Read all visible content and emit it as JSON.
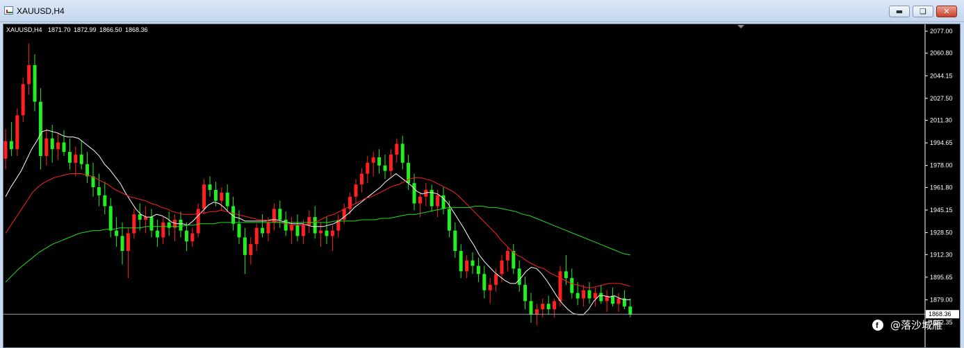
{
  "window": {
    "title": "XAUUSD,H4",
    "minimize_icon": "minimize-icon",
    "restore_icon": "restore-icon",
    "close_icon": "close-icon"
  },
  "chart_header": {
    "symbol": "XAUUSD,H4",
    "open": "1871.70",
    "high": "1872.99",
    "low": "1866.50",
    "close": "1868.36"
  },
  "watermark": {
    "icon": "facebook-icon",
    "text": "@落沙城雁"
  },
  "chart_data": {
    "type": "candlestick",
    "title": "",
    "ylim": [
      1862.35,
      2077.0
    ],
    "y_ticks": [
      "2077.00",
      "2060.80",
      "2044.15",
      "2027.50",
      "2011.30",
      "1994.65",
      "1978.00",
      "1961.80",
      "1945.15",
      "1928.50",
      "1912.30",
      "1895.65",
      "1879.00",
      "1862.35"
    ],
    "current_price": 1868.36,
    "colors": {
      "bull": "#ff2020",
      "bear": "#22ee22",
      "background": "#000000",
      "price_line": "#9aa4b0"
    },
    "moving_averages": [
      {
        "color": "#ffffff",
        "values": [
          1955,
          1962,
          1968,
          1974,
          1982,
          1990,
          1996,
          2003,
          2004,
          2003,
          2002,
          2000,
          1999,
          1999,
          1998,
          1995,
          1992,
          1989,
          1985,
          1979,
          1975,
          1970,
          1965,
          1958,
          1952,
          1946,
          1942,
          1940,
          1940,
          1942,
          1941,
          1939,
          1936,
          1935,
          1935,
          1934,
          1937,
          1941,
          1945,
          1949,
          1951,
          1950,
          1947,
          1943,
          1940,
          1939,
          1937,
          1937,
          1937,
          1937,
          1937,
          1938,
          1938,
          1937,
          1936,
          1935,
          1935,
          1935,
          1934,
          1933,
          1933,
          1933,
          1934,
          1935,
          1937,
          1940,
          1943,
          1947,
          1950,
          1953,
          1956,
          1959,
          1962,
          1966,
          1969,
          1972,
          1969,
          1966,
          1963,
          1959,
          1957,
          1958,
          1958,
          1957,
          1954,
          1950,
          1944,
          1938,
          1932,
          1925,
          1919,
          1912,
          1907,
          1903,
          1899,
          1896,
          1893,
          1891,
          1891,
          1895,
          1900,
          1903,
          1902,
          1898,
          1893,
          1887,
          1881,
          1876,
          1872,
          1869,
          1868,
          1868,
          1872,
          1878,
          1882,
          1882,
          1881,
          1882,
          1880,
          1879,
          1879
        ]
      },
      {
        "color": "#ff2020",
        "values": [
          1928,
          1934,
          1940,
          1946,
          1952,
          1958,
          1962,
          1965,
          1967,
          1969,
          1970,
          1971,
          1972,
          1972,
          1972,
          1971,
          1970,
          1968,
          1966,
          1964,
          1961,
          1959,
          1957,
          1955,
          1954,
          1953,
          1952,
          1950,
          1949,
          1947,
          1946,
          1944,
          1943,
          1942,
          1942,
          1942,
          1943,
          1943,
          1944,
          1944,
          1945,
          1944,
          1943,
          1942,
          1941,
          1940,
          1939,
          1938,
          1938,
          1937,
          1937,
          1936,
          1935,
          1934,
          1934,
          1934,
          1935,
          1936,
          1937,
          1939,
          1941,
          1942,
          1944,
          1946,
          1948,
          1950,
          1952,
          1954,
          1955,
          1957,
          1959,
          1961,
          1963,
          1964,
          1966,
          1968,
          1969,
          1969,
          1968,
          1967,
          1965,
          1963,
          1961,
          1959,
          1956,
          1952,
          1948,
          1944,
          1940,
          1936,
          1932,
          1928,
          1923,
          1919,
          1915,
          1912,
          1910,
          1907,
          1905,
          1903,
          1902,
          1899,
          1897,
          1895,
          1893,
          1891,
          1890,
          1889,
          1888,
          1888,
          1889,
          1890,
          1891,
          1891,
          1891,
          1890,
          1889
        ]
      },
      {
        "color": "#22dd22",
        "values": [
          1892,
          1897,
          1902,
          1906,
          1910,
          1914,
          1917,
          1920,
          1922,
          1924,
          1926,
          1928,
          1929,
          1930,
          1930,
          1931,
          1931,
          1932,
          1932,
          1932,
          1932,
          1933,
          1933,
          1933,
          1933,
          1933,
          1933,
          1934,
          1934,
          1935,
          1935,
          1935,
          1936,
          1936,
          1936,
          1936,
          1936,
          1936,
          1936,
          1936,
          1936,
          1936,
          1936,
          1936,
          1936,
          1936,
          1936,
          1936,
          1936,
          1937,
          1937,
          1937,
          1937,
          1938,
          1938,
          1938,
          1939,
          1939,
          1940,
          1941,
          1942,
          1942,
          1943,
          1944,
          1945,
          1946,
          1947,
          1947,
          1947,
          1947,
          1948,
          1948,
          1947,
          1947,
          1946,
          1945,
          1944,
          1942,
          1941,
          1939,
          1937,
          1935,
          1933,
          1931,
          1929,
          1927,
          1925,
          1923,
          1921,
          1919,
          1917,
          1915,
          1913,
          1912
        ]
      }
    ],
    "candles": [
      [
        1983,
        2005,
        1975,
        1996
      ],
      [
        1996,
        2010,
        1985,
        1990
      ],
      [
        1990,
        2020,
        1985,
        2015
      ],
      [
        2015,
        2043,
        2010,
        2038
      ],
      [
        2038,
        2068,
        2030,
        2052
      ],
      [
        2052,
        2060,
        2018,
        2025
      ],
      [
        2025,
        2035,
        1975,
        1985
      ],
      [
        1985,
        2005,
        1978,
        1998
      ],
      [
        1998,
        2008,
        1980,
        1990
      ],
      [
        1990,
        2002,
        1982,
        1995
      ],
      [
        1995,
        2004,
        1985,
        1988
      ],
      [
        1988,
        1998,
        1975,
        1980
      ],
      [
        1980,
        1992,
        1970,
        1986
      ],
      [
        1986,
        1996,
        1975,
        1979
      ],
      [
        1979,
        1988,
        1965,
        1970
      ],
      [
        1970,
        1980,
        1955,
        1962
      ],
      [
        1962,
        1972,
        1948,
        1956
      ],
      [
        1956,
        1966,
        1942,
        1948
      ],
      [
        1948,
        1954,
        1925,
        1930
      ],
      [
        1930,
        1940,
        1918,
        1926
      ],
      [
        1926,
        1936,
        1905,
        1915
      ],
      [
        1915,
        1932,
        1895,
        1928
      ],
      [
        1928,
        1946,
        1924,
        1942
      ],
      [
        1942,
        1950,
        1930,
        1938
      ],
      [
        1938,
        1948,
        1928,
        1940
      ],
      [
        1940,
        1946,
        1925,
        1930
      ],
      [
        1930,
        1938,
        1918,
        1925
      ],
      [
        1925,
        1940,
        1920,
        1936
      ],
      [
        1936,
        1944,
        1926,
        1932
      ],
      [
        1932,
        1942,
        1922,
        1938
      ],
      [
        1938,
        1944,
        1925,
        1930
      ],
      [
        1930,
        1936,
        1915,
        1922
      ],
      [
        1922,
        1932,
        1918,
        1928
      ],
      [
        1928,
        1950,
        1925,
        1946
      ],
      [
        1946,
        1968,
        1942,
        1964
      ],
      [
        1964,
        1970,
        1955,
        1960
      ],
      [
        1960,
        1966,
        1948,
        1952
      ],
      [
        1952,
        1962,
        1945,
        1958
      ],
      [
        1958,
        1964,
        1945,
        1948
      ],
      [
        1948,
        1955,
        1930,
        1935
      ],
      [
        1935,
        1945,
        1920,
        1925
      ],
      [
        1925,
        1932,
        1898,
        1912
      ],
      [
        1912,
        1925,
        1905,
        1920
      ],
      [
        1920,
        1935,
        1915,
        1932
      ],
      [
        1932,
        1942,
        1925,
        1928
      ],
      [
        1928,
        1940,
        1922,
        1936
      ],
      [
        1936,
        1950,
        1930,
        1946
      ],
      [
        1946,
        1952,
        1932,
        1938
      ],
      [
        1938,
        1944,
        1926,
        1930
      ],
      [
        1930,
        1940,
        1920,
        1934
      ],
      [
        1934,
        1942,
        1922,
        1926
      ],
      [
        1926,
        1938,
        1920,
        1934
      ],
      [
        1934,
        1945,
        1928,
        1940
      ],
      [
        1940,
        1948,
        1924,
        1928
      ],
      [
        1928,
        1936,
        1918,
        1930
      ],
      [
        1930,
        1940,
        1920,
        1926
      ],
      [
        1926,
        1934,
        1915,
        1930
      ],
      [
        1930,
        1942,
        1925,
        1938
      ],
      [
        1938,
        1950,
        1935,
        1946
      ],
      [
        1946,
        1958,
        1942,
        1955
      ],
      [
        1955,
        1968,
        1950,
        1964
      ],
      [
        1964,
        1976,
        1958,
        1972
      ],
      [
        1972,
        1985,
        1965,
        1980
      ],
      [
        1980,
        1988,
        1970,
        1984
      ],
      [
        1984,
        1990,
        1972,
        1978
      ],
      [
        1978,
        1986,
        1968,
        1974
      ],
      [
        1974,
        1990,
        1970,
        1986
      ],
      [
        1986,
        1998,
        1980,
        1994
      ],
      [
        1994,
        2000,
        1975,
        1980
      ],
      [
        1980,
        1986,
        1960,
        1965
      ],
      [
        1965,
        1972,
        1945,
        1950
      ],
      [
        1950,
        1958,
        1940,
        1955
      ],
      [
        1955,
        1965,
        1948,
        1960
      ],
      [
        1960,
        1964,
        1944,
        1948
      ],
      [
        1948,
        1960,
        1940,
        1956
      ],
      [
        1956,
        1962,
        1942,
        1946
      ],
      [
        1946,
        1952,
        1925,
        1930
      ],
      [
        1930,
        1936,
        1910,
        1915
      ],
      [
        1915,
        1920,
        1895,
        1900
      ],
      [
        1900,
        1912,
        1895,
        1908
      ],
      [
        1908,
        1914,
        1898,
        1904
      ],
      [
        1904,
        1910,
        1892,
        1898
      ],
      [
        1898,
        1904,
        1880,
        1886
      ],
      [
        1886,
        1895,
        1876,
        1890
      ],
      [
        1890,
        1902,
        1885,
        1898
      ],
      [
        1898,
        1912,
        1892,
        1908
      ],
      [
        1908,
        1918,
        1900,
        1915
      ],
      [
        1915,
        1920,
        1898,
        1902
      ],
      [
        1902,
        1908,
        1885,
        1890
      ],
      [
        1890,
        1896,
        1872,
        1878
      ],
      [
        1878,
        1884,
        1862,
        1868
      ],
      [
        1868,
        1876,
        1860,
        1872
      ],
      [
        1872,
        1880,
        1866,
        1876
      ],
      [
        1876,
        1882,
        1868,
        1872
      ],
      [
        1872,
        1880,
        1866,
        1878
      ],
      [
        1878,
        1904,
        1874,
        1900
      ],
      [
        1900,
        1912,
        1890,
        1895
      ],
      [
        1895,
        1902,
        1880,
        1884
      ],
      [
        1884,
        1892,
        1875,
        1880
      ],
      [
        1880,
        1890,
        1874,
        1886
      ],
      [
        1886,
        1892,
        1876,
        1880
      ],
      [
        1880,
        1888,
        1874,
        1884
      ],
      [
        1884,
        1890,
        1876,
        1878
      ],
      [
        1878,
        1886,
        1870,
        1882
      ],
      [
        1882,
        1888,
        1874,
        1876
      ],
      [
        1876,
        1884,
        1870,
        1880
      ],
      [
        1880,
        1886,
        1872,
        1874
      ],
      [
        1874,
        1880,
        1866,
        1868
      ]
    ]
  }
}
